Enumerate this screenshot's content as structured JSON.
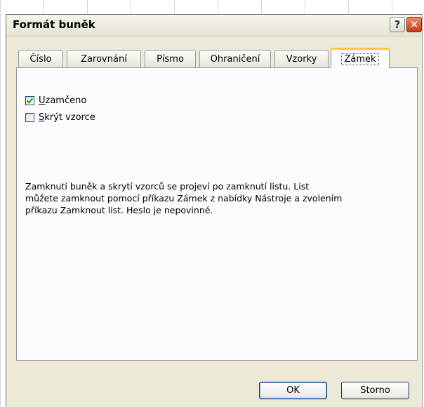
{
  "dialog": {
    "title": "Formát buněk",
    "help_glyph": "?",
    "close_glyph": "✕"
  },
  "tabs": [
    {
      "label": "Číslo",
      "active": false
    },
    {
      "label": "Zarovnání",
      "active": false
    },
    {
      "label": "Písmo",
      "active": false
    },
    {
      "label": "Ohraničení",
      "active": false
    },
    {
      "label": "Vzorky",
      "active": false
    },
    {
      "label": "Zámek",
      "active": true
    }
  ],
  "protection": {
    "locked": {
      "label_key": "U",
      "label_rest": "zamčeno",
      "checked": true
    },
    "hidden": {
      "label_key": "S",
      "label_rest": "krýt vzorce",
      "checked": false
    },
    "info_lines": [
      "Zamknutí buněk a skrytí vzorců se projeví po zamknutí listu. List",
      "můžete zamknout pomocí příkazu Zámek z nabídky Nástroje a zvolením",
      "příkazu Zamknout list. Heslo je nepovinné."
    ]
  },
  "buttons": {
    "ok": "OK",
    "cancel": "Storno"
  },
  "colors": {
    "dialog_bg": "#ece9d8",
    "active_tab_accent": "#ffc83c",
    "close_button": "#c8361a",
    "check_mark": "#21a121"
  },
  "icons": {
    "help": "help-icon",
    "close": "close-icon",
    "check": "check-icon"
  }
}
